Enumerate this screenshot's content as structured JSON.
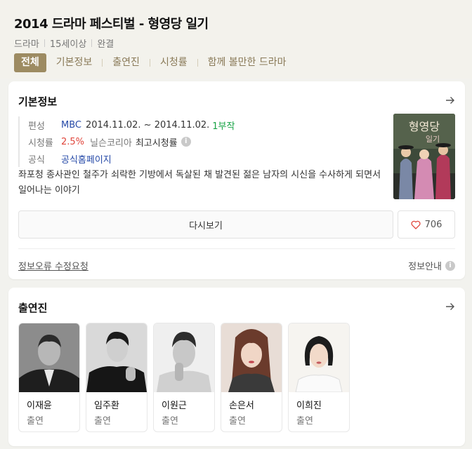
{
  "header": {
    "title": "2014 드라마 페스티벌 - 형영당 일기",
    "meta": [
      "드라마",
      "15세이상",
      "완결"
    ],
    "tabs": [
      {
        "label": "전체",
        "active": true
      },
      {
        "label": "기본정보"
      },
      {
        "label": "출연진"
      },
      {
        "label": "시청률"
      },
      {
        "label": "함께 볼만한 드라마"
      }
    ]
  },
  "basic_info": {
    "title": "기본정보",
    "rows": {
      "broadcast": {
        "label": "편성",
        "channel": "MBC",
        "date": "2014.11.02. ~ 2014.11.02.",
        "episodes": "1부작"
      },
      "rating": {
        "label": "시청률",
        "value": "2.5%",
        "source": "닐슨코리아",
        "note": "최고시청률"
      },
      "official": {
        "label": "공식",
        "link": "공식홈페이지"
      }
    },
    "synopsis": "좌포청 종사관인 철주가 쇠락한 기방에서 독살된 채 발견된 젊은 남자의 시신을 수사하게 되면서 일어나는 이야기",
    "rewatch_label": "다시보기",
    "like_count": "706",
    "report_link": "정보오류 수정요청",
    "info_guide": "정보안내"
  },
  "cast": {
    "title": "출연진",
    "members": [
      {
        "name": "이재윤",
        "role": "출연"
      },
      {
        "name": "임주환",
        "role": "출연"
      },
      {
        "name": "이원근",
        "role": "출연"
      },
      {
        "name": "손은서",
        "role": "출연"
      },
      {
        "name": "이희진",
        "role": "출연"
      }
    ]
  }
}
